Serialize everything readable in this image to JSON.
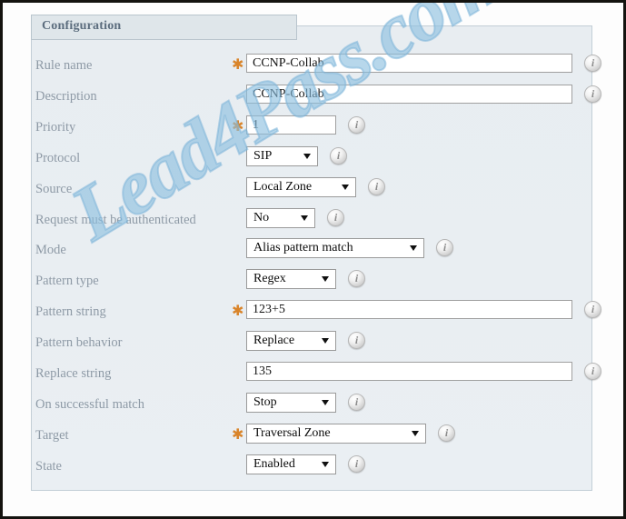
{
  "panel": {
    "legend": "Configuration"
  },
  "watermark": {
    "text": "Lead4Pass.com",
    "color": "#8bbede"
  },
  "theme": {
    "panel_background": "#e9eef2",
    "legend_background": "#dfe6ea",
    "label_color": "#8e9aa6",
    "required_marker_color": "#d9842a",
    "input_background": "#ffffff",
    "input_border": "#a0a0a0",
    "frame_color": "#14130f"
  },
  "icons": {
    "info": "info-icon",
    "required": "required-star-icon",
    "dropdown": "chevron-down-icon"
  },
  "form": {
    "required_marker": "✱",
    "rows": [
      {
        "label": "Rule name",
        "control": "text",
        "required": true,
        "value": "CCNP-Collab",
        "placeholder": "",
        "width": "wide",
        "info": true
      },
      {
        "label": "Description",
        "control": "text",
        "required": false,
        "value": "CCNP-Collab",
        "placeholder": "",
        "width": "wide",
        "info": true
      },
      {
        "label": "Priority",
        "control": "text",
        "required": true,
        "value": "1",
        "placeholder": "",
        "width": "narrow",
        "info": true
      },
      {
        "label": "Protocol",
        "control": "select",
        "required": false,
        "value": "SIP",
        "width": "w-sip",
        "info": true
      },
      {
        "label": "Source",
        "control": "select",
        "required": false,
        "value": "Local Zone",
        "width": "w-zone",
        "info": true
      },
      {
        "label": "Request must be authenticated",
        "control": "select",
        "required": false,
        "value": "No",
        "width": "w-no",
        "info": true
      },
      {
        "label": "Mode",
        "control": "select",
        "required": false,
        "value": "Alias pattern match",
        "width": "w-mode",
        "info": true
      },
      {
        "label": "Pattern type",
        "control": "select",
        "required": false,
        "value": "Regex",
        "width": "w-reg",
        "info": true
      },
      {
        "label": "Pattern string",
        "control": "text",
        "required": true,
        "value": "123+5",
        "placeholder": "",
        "width": "wide",
        "info": true
      },
      {
        "label": "Pattern behavior",
        "control": "select",
        "required": false,
        "value": "Replace",
        "width": "w-rep",
        "info": true
      },
      {
        "label": "Replace string",
        "control": "text",
        "required": false,
        "value": "135",
        "placeholder": "",
        "width": "wide",
        "info": true
      },
      {
        "label": "On successful match",
        "control": "select",
        "required": false,
        "value": "Stop",
        "width": "w-stop",
        "info": true
      },
      {
        "label": "Target",
        "control": "select",
        "required": true,
        "value": "Traversal Zone",
        "width": "w-trav",
        "info": true
      },
      {
        "label": "State",
        "control": "select",
        "required": false,
        "value": "Enabled",
        "width": "w-en",
        "info": true
      }
    ]
  }
}
